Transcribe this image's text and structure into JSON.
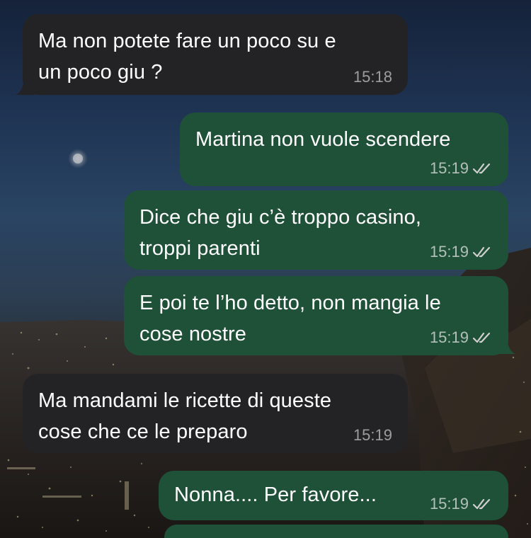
{
  "messages": [
    {
      "direction": "in",
      "text": "Ma non potete fare un poco su e\nun poco giu ?",
      "time": "15:18",
      "read_icon": ""
    },
    {
      "direction": "out",
      "text": "Martina non vuole scendere",
      "time": "15:19",
      "read_icon": "double-check-icon"
    },
    {
      "direction": "out",
      "text": "Dice che giu c’è troppo casino,\ntroppi parenti",
      "time": "15:19",
      "read_icon": "double-check-icon"
    },
    {
      "direction": "out",
      "text": "E poi te l’ho detto, non mangia le\ncose nostre",
      "time": "15:19",
      "read_icon": "double-check-icon"
    },
    {
      "direction": "in",
      "text": "Ma mandami le ricette di queste\ncose che ce le preparo",
      "time": "15:19",
      "read_icon": ""
    },
    {
      "direction": "out",
      "text": "Nonna.... Per favore...",
      "time": "15:19",
      "read_icon": "double-check-icon"
    }
  ],
  "colors": {
    "incoming_bubble": "#232325",
    "outgoing_bubble": "#1f5038",
    "text": "#ffffff",
    "timestamp": "#c8c8c8"
  }
}
